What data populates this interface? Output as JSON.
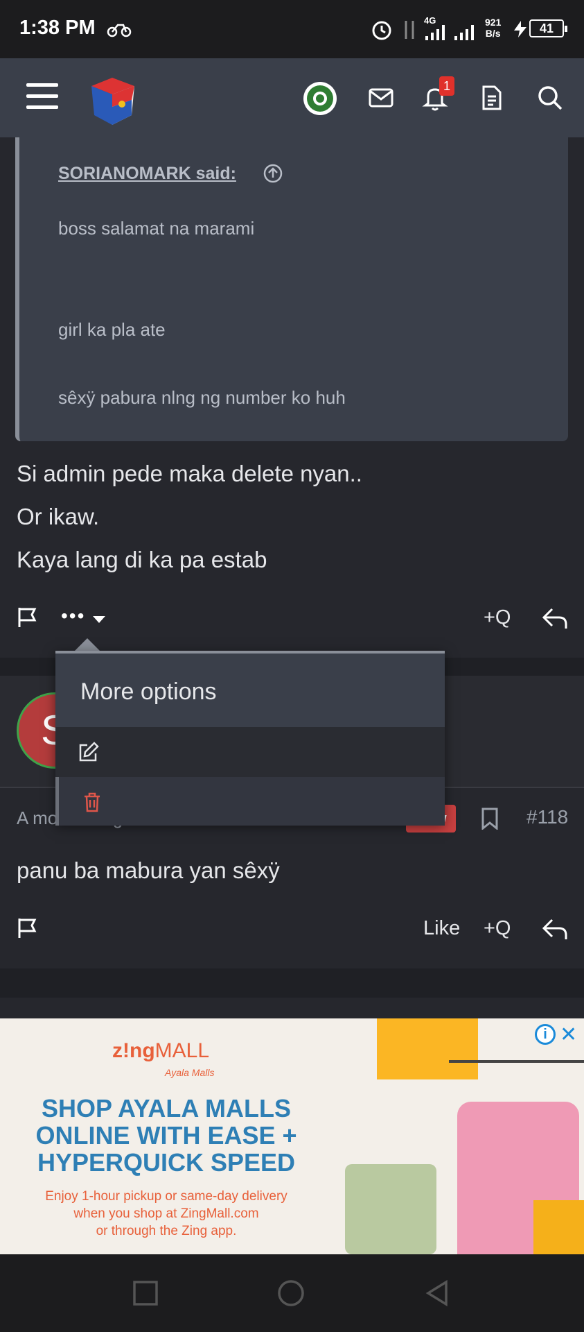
{
  "status_bar": {
    "time": "1:38 PM",
    "network": "4G",
    "net_speed_value": "921",
    "net_speed_unit": "B/s",
    "battery": "41"
  },
  "top_nav": {
    "notification_count": "1",
    "icons": [
      "menu-icon",
      "site-logo",
      "user-avatar",
      "mail-icon",
      "bell-icon",
      "document-icon",
      "search-icon"
    ]
  },
  "quote": {
    "author": "SORIANOMARK said:",
    "lines": [
      "boss salamat na marami",
      "girl ka pla ate",
      "sêxÿ pabura nlng ng number ko huh"
    ]
  },
  "post_117": {
    "lines": [
      "Si admin pede maka delete nyan..",
      "Or ikaw.",
      "Kaya lang di ka pa estab"
    ],
    "more": "•••",
    "quote_action": "+Q"
  },
  "more_options_menu": {
    "title": "More options",
    "items": [
      {
        "icon": "edit-icon",
        "color": "#e6e7ea"
      },
      {
        "icon": "trash-icon",
        "color": "#e0564a"
      }
    ]
  },
  "post_118": {
    "avatar_letter": "S",
    "timestamp": "A moment ago",
    "new_badge": "New",
    "post_number": "#118",
    "text": "panu ba mabura yan sêxÿ",
    "like": "Like",
    "quote_action": "+Q"
  },
  "ad": {
    "logo_z": "z!ng",
    "logo_mall": "MALL",
    "logo_sub": "Ayala Malls",
    "headline": [
      "SHOP AYALA MALLS",
      "ONLINE WITH EASE +",
      "HYPERQUICK SPEED"
    ],
    "body": [
      "Enjoy 1-hour pickup or same-day delivery",
      "when you shop at ZingMall.com",
      "or through the Zing app."
    ],
    "info": "i",
    "close": "✕"
  },
  "colors": {
    "background": "#26272d",
    "panel": "#3a3f4a",
    "accent_red": "#c94040",
    "ad_blue": "#2e7fb5",
    "ad_orange": "#e8603a"
  }
}
